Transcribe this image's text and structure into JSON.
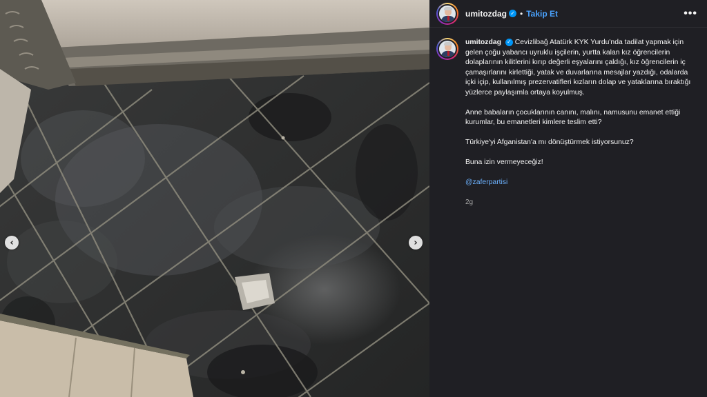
{
  "post": {
    "username": "umitozdag",
    "verified_icon": "verified-badge-icon",
    "separator": "•",
    "follow_label": "Takip Et",
    "more_label": "•••",
    "caption_paragraphs": [
      "Cevizlibağ Atatürk KYK Yurdu'nda tadilat yapmak için gelen çoğu yabancı uyruklu işçilerin, yurtta kalan kız öğrencilerin dolaplarının kilitlerini kırıp değerli eşyalarını çaldığı, kız öğrencilerin iç çamaşırlarını kirlettiği, yatak ve duvarlarına mesajlar yazdığı, odalarda içki içip, kullanılmış prezervatifleri kızların dolap ve yataklarına bıraktığı yüzlerce paylaşımla ortaya koyulmuş.",
      "Anne babaların çocuklarının canını, malını, namusunu emanet ettiği kurumlar, bu emanetleri kimlere teslim etti?",
      "Türkiye'yi Afganistan'a mı dönüştürmek istiyorsunuz?",
      "Buna izin vermeyeceğiz!"
    ],
    "mention": "@zaferpartisi",
    "time_ago": "2g"
  },
  "media": {
    "prev_icon": "‹",
    "next_icon": "›"
  },
  "colors": {
    "panel_bg": "#1f1f24",
    "link": "#4aa3ff",
    "verified": "#0095f6"
  }
}
